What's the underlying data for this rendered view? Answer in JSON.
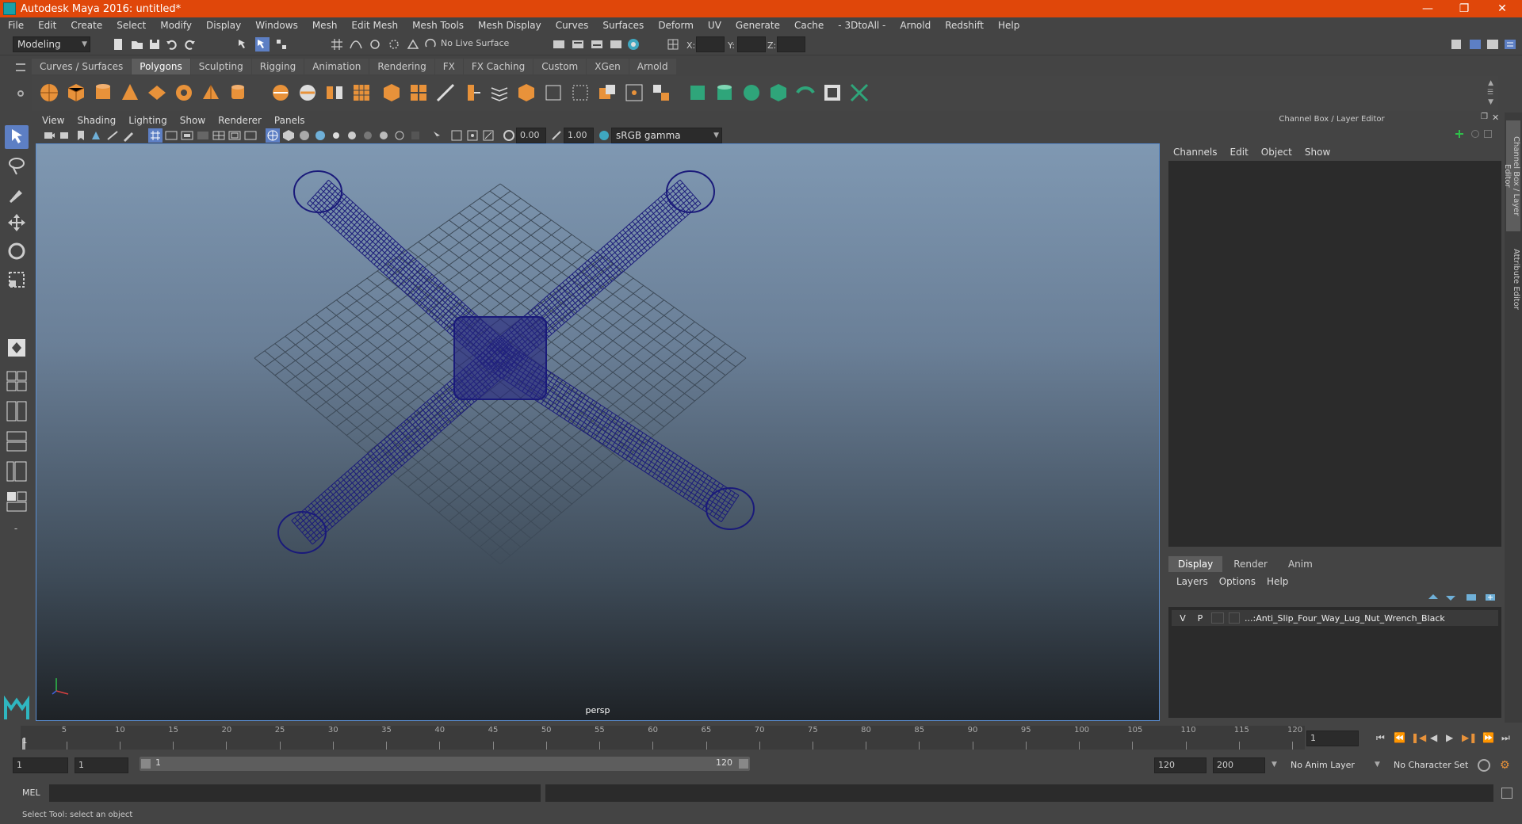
{
  "window": {
    "title": "Autodesk Maya 2016: untitled*"
  },
  "menu": [
    "File",
    "Edit",
    "Create",
    "Select",
    "Modify",
    "Display",
    "Windows",
    "Mesh",
    "Edit Mesh",
    "Mesh Tools",
    "Mesh Display",
    "Curves",
    "Surfaces",
    "Deform",
    "UV",
    "Generate",
    "Cache",
    "- 3DtoAll -",
    "Arnold",
    "Redshift",
    "Help"
  ],
  "status": {
    "mode": "Modeling",
    "live_surface": "No Live Surface",
    "x_label": "X:",
    "y_label": "Y:",
    "z_label": "Z:"
  },
  "shelf": {
    "tabs": [
      "Curves / Surfaces",
      "Polygons",
      "Sculpting",
      "Rigging",
      "Animation",
      "Rendering",
      "FX",
      "FX Caching",
      "Custom",
      "XGen",
      "Arnold"
    ],
    "active": "Polygons"
  },
  "viewport": {
    "menu": [
      "View",
      "Shading",
      "Lighting",
      "Show",
      "Renderer",
      "Panels"
    ],
    "exposure": "0.00",
    "gamma": "1.00",
    "color_space": "sRGB gamma",
    "camera": "persp"
  },
  "channel_box": {
    "header": "Channel Box / Layer Editor",
    "menu": [
      "Channels",
      "Edit",
      "Object",
      "Show"
    ]
  },
  "layer_editor": {
    "tabs": [
      "Display",
      "Render",
      "Anim"
    ],
    "active": "Display",
    "menu": [
      "Layers",
      "Options",
      "Help"
    ],
    "layers": [
      {
        "v": "V",
        "p": "P",
        "name": "...:Anti_Slip_Four_Way_Lug_Nut_Wrench_Black"
      }
    ]
  },
  "side_tabs": [
    "Channel Box / Layer Editor",
    "Attribute Editor"
  ],
  "time_slider": {
    "ticks": [
      5,
      10,
      15,
      20,
      25,
      30,
      35,
      40,
      45,
      50,
      55,
      60,
      65,
      70,
      75,
      80,
      85,
      90,
      95,
      100,
      105,
      110,
      115,
      120
    ],
    "start_label": "1",
    "current_frame": "1"
  },
  "range": {
    "start": "1",
    "playback_start": "1",
    "slider_start": "1",
    "slider_end": "120",
    "playback_end": "120",
    "end": "200",
    "anim_layer": "No Anim Layer",
    "character_set": "No Character Set"
  },
  "command": {
    "label": "MEL"
  },
  "help_line": "Select Tool: select an object",
  "colors": {
    "title_bar": "#e0470a",
    "accent": "#5d7fc4",
    "wireframe": "#1a1a7a",
    "shelf_icon": "#e8923a"
  }
}
